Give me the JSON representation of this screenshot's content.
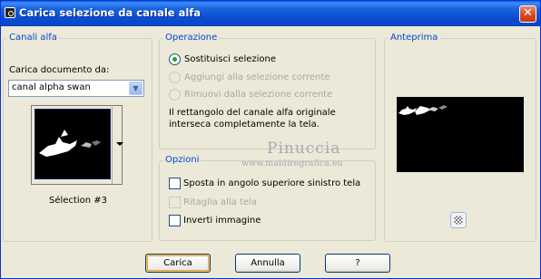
{
  "window": {
    "title": "Carica selezione da canale alfa",
    "close_glyph": "✕"
  },
  "canali_alfa": {
    "legend": "Canali alfa",
    "doc_label": "Carica documento da:",
    "doc_value": "canal alpha swan",
    "selection_caption": "Sélection #3"
  },
  "operazione": {
    "legend": "Operazione",
    "options": [
      {
        "label": "Sostituisci selezione",
        "checked": true,
        "enabled": true
      },
      {
        "label": "Aggiungi alla selezione corrente",
        "checked": false,
        "enabled": false
      },
      {
        "label": "Rimuovi dalla selezione corrente",
        "checked": false,
        "enabled": false
      }
    ],
    "info_line1": "Il rettangolo del canale alfa originale",
    "info_line2": "interseca completamente la tela."
  },
  "opzioni": {
    "legend": "Opzioni",
    "items": [
      {
        "label": "Sposta in angolo superiore sinistro tela",
        "checked": false,
        "enabled": true
      },
      {
        "label": "Ritaglia alla tela",
        "checked": false,
        "enabled": false
      },
      {
        "label": "Inverti immagine",
        "checked": false,
        "enabled": true
      }
    ]
  },
  "anteprima": {
    "legend": "Anteprima"
  },
  "watermark": {
    "line1": "Pinuccia",
    "line2": "www.maidiregrafica.eu"
  },
  "buttons": {
    "ok": "Carica",
    "cancel": "Annulla",
    "help": "?"
  },
  "icons": {
    "app": "app-icon",
    "close": "close-icon",
    "dropdown": "chevron-down-icon",
    "zoom": "zoom-checker-icon"
  },
  "colors": {
    "titlebar": "#0a4bd1",
    "legend_text": "#0046d5",
    "dialog_bg": "#ece9d8",
    "radio_dot": "#21a121"
  }
}
